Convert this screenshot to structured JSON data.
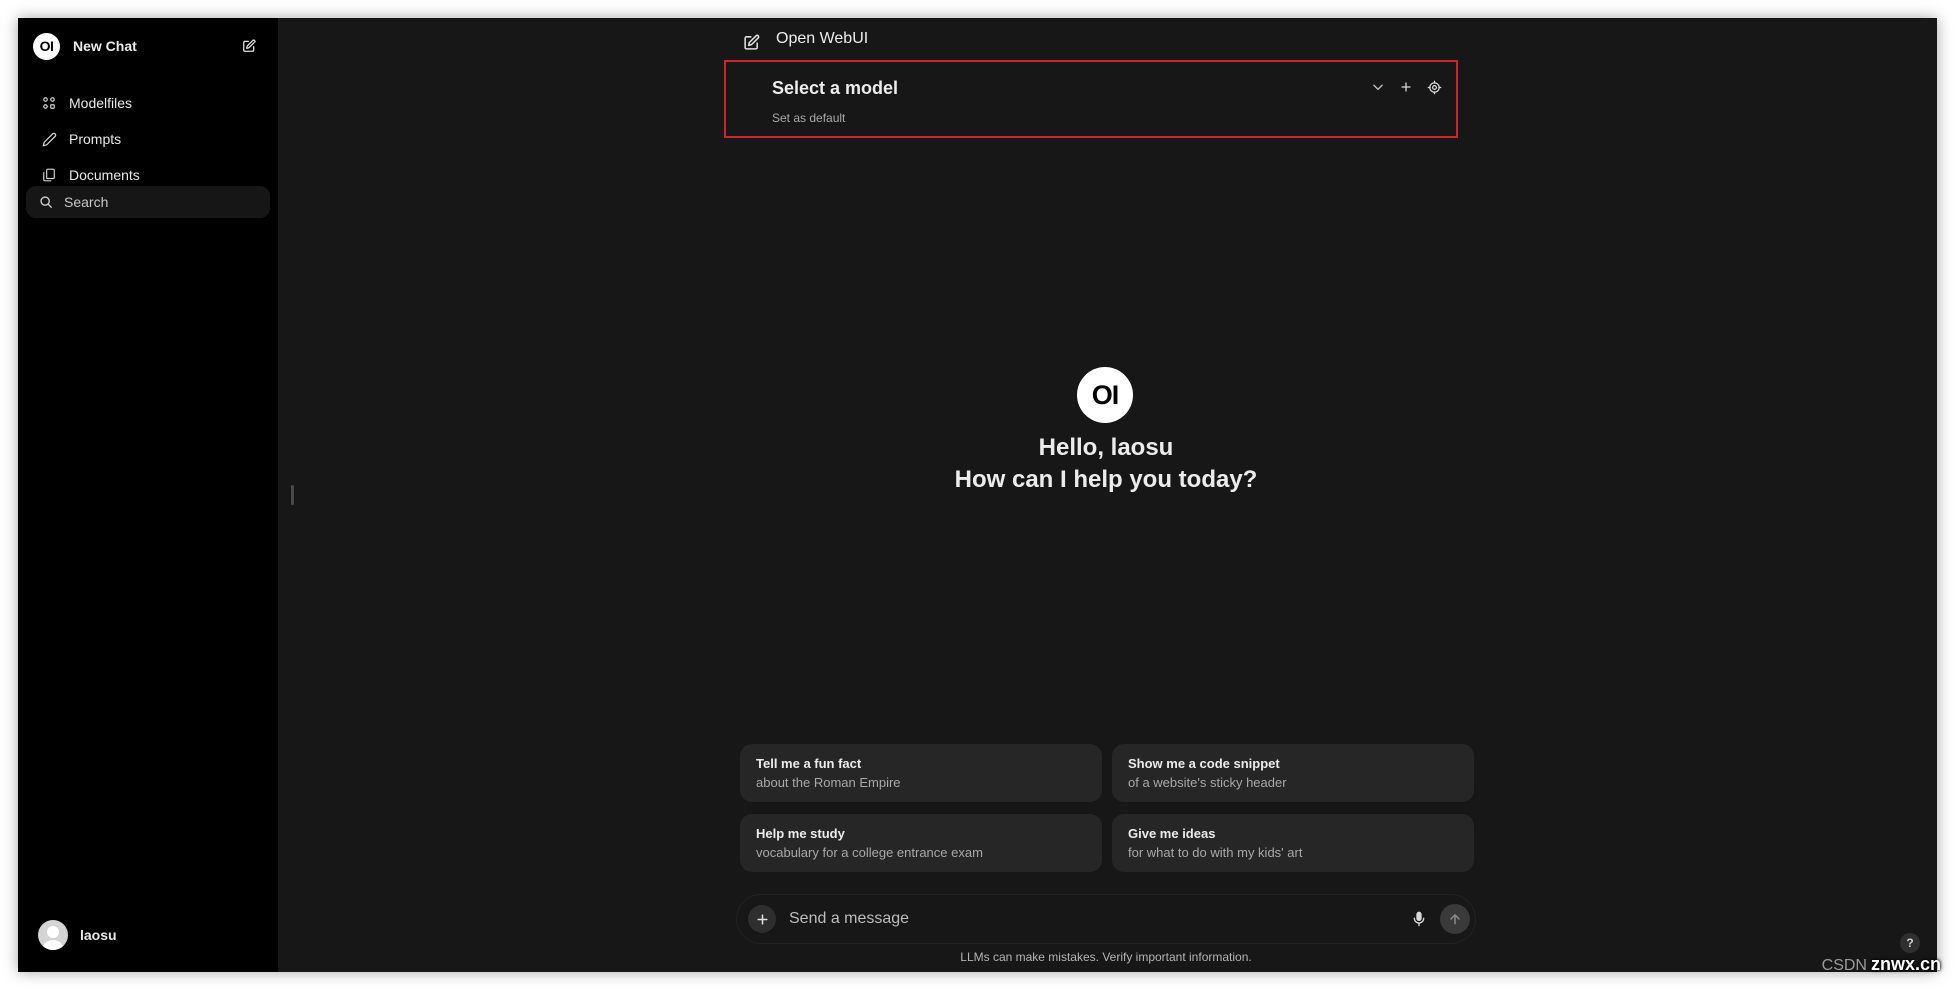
{
  "sidebar": {
    "new_chat_label": "New Chat",
    "logo_text": "OI",
    "items": [
      {
        "label": "Modelfiles",
        "icon": "modelfiles-icon"
      },
      {
        "label": "Prompts",
        "icon": "pencil-icon"
      },
      {
        "label": "Documents",
        "icon": "documents-icon"
      }
    ],
    "search_placeholder": "Search",
    "user_name": "laosu"
  },
  "header": {
    "app_title": "Open WebUI",
    "model_selector": {
      "title": "Select a model",
      "set_default": "Set as default"
    }
  },
  "hero": {
    "logo_text": "OI",
    "greeting": "Hello, laosu",
    "question": "How can I help you today?"
  },
  "suggestions": [
    {
      "title": "Tell me a fun fact",
      "subtitle": "about the Roman Empire"
    },
    {
      "title": "Show me a code snippet",
      "subtitle": "of a website's sticky header"
    },
    {
      "title": "Help me study",
      "subtitle": "vocabulary for a college entrance exam"
    },
    {
      "title": "Give me ideas",
      "subtitle": "for what to do with my kids' art"
    }
  ],
  "composer": {
    "placeholder": "Send a message",
    "disclaimer": "LLMs can make mistakes. Verify important information."
  },
  "help_label": "?",
  "watermark": {
    "prefix": "CSDN",
    "text": "znwx.cn"
  },
  "colors": {
    "background": "#171717",
    "sidebar": "#000000",
    "highlight_border": "#d0232a",
    "card": "#262626"
  }
}
